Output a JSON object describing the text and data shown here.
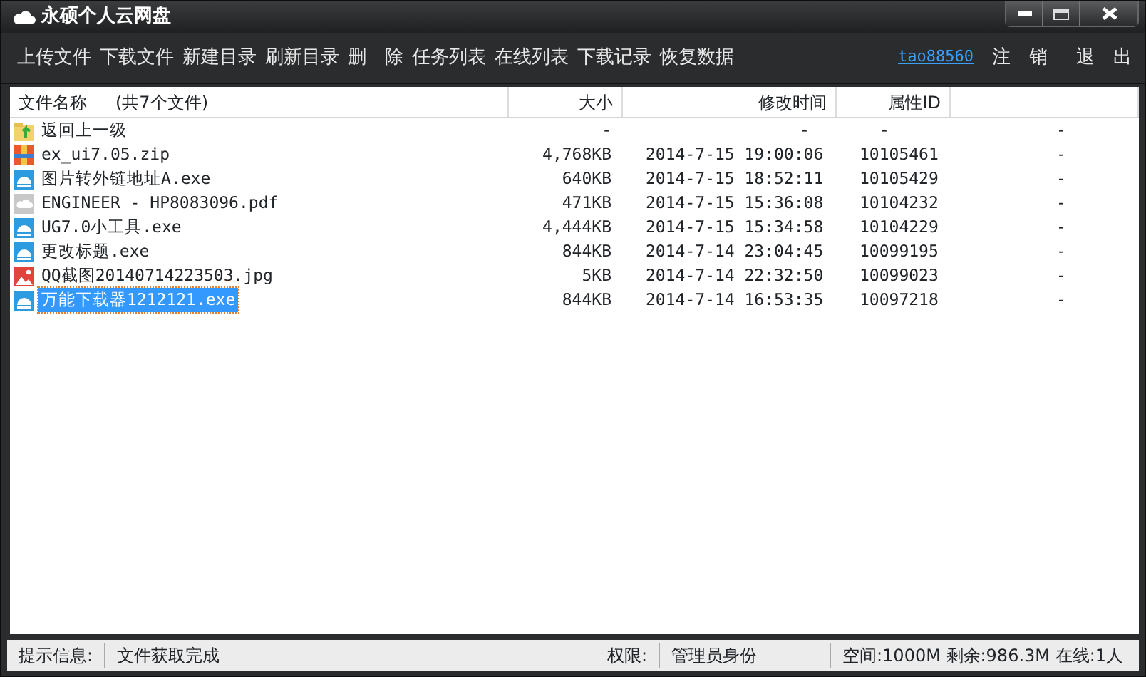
{
  "window": {
    "title": "永硕个人云网盘"
  },
  "toolbar": {
    "buttons": [
      "上传文件",
      "下载文件",
      "新建目录",
      "刷新目录",
      "删　除",
      "任务列表",
      "在线列表",
      "下载记录",
      "恢复数据"
    ],
    "user_link": "tao88560",
    "right_buttons": [
      "注　销",
      "退　出"
    ]
  },
  "table": {
    "columns": [
      {
        "label": "文件名称",
        "note": "(共7个文件)"
      },
      {
        "label": "大小"
      },
      {
        "label": "修改时间"
      },
      {
        "label": "属性ID"
      }
    ],
    "rows": [
      {
        "kind": "folder-up",
        "name": "返回上一级",
        "size": "-",
        "modified": "-",
        "attr_id": "-",
        "column_5": "-",
        "selected": false
      },
      {
        "kind": "zip",
        "name": "ex_ui7.05.zip",
        "size": "4,768KB",
        "modified": "2014-7-15 19:00:06",
        "attr_id": "10105461",
        "column_5": "-",
        "selected": false
      },
      {
        "kind": "exe",
        "name": "图片转外链地址A.exe",
        "size": "640KB",
        "modified": "2014-7-15 18:52:11",
        "attr_id": "10105429",
        "column_5": "-",
        "selected": false
      },
      {
        "kind": "cloud",
        "name": "ENGINEER - HP8083096.pdf",
        "size": "471KB",
        "modified": "2014-7-15 15:36:08",
        "attr_id": "10104232",
        "column_5": "-",
        "selected": false
      },
      {
        "kind": "exe",
        "name": "UG7.0小工具.exe",
        "size": "4,444KB",
        "modified": "2014-7-15 15:34:58",
        "attr_id": "10104229",
        "column_5": "-",
        "selected": false
      },
      {
        "kind": "exe",
        "name": "更改标题.exe",
        "size": "844KB",
        "modified": "2014-7-14 23:04:45",
        "attr_id": "10099195",
        "column_5": "-",
        "selected": false
      },
      {
        "kind": "image",
        "name": "QQ截图20140714223503.jpg",
        "size": "5KB",
        "modified": "2014-7-14 22:32:50",
        "attr_id": "10099023",
        "column_5": "-",
        "selected": false
      },
      {
        "kind": "exe",
        "name": "万能下载器1212121.exe",
        "size": "844KB",
        "modified": "2014-7-14 16:53:35",
        "attr_id": "10097218",
        "column_5": "-",
        "selected": true
      }
    ]
  },
  "status_bar": {
    "label": "提示信息:",
    "message": "文件获取完成",
    "perm_label": "权限:",
    "perm_value": "管理员身份",
    "space": "空间:1000M 剩余:986.3M 在线:1人"
  }
}
